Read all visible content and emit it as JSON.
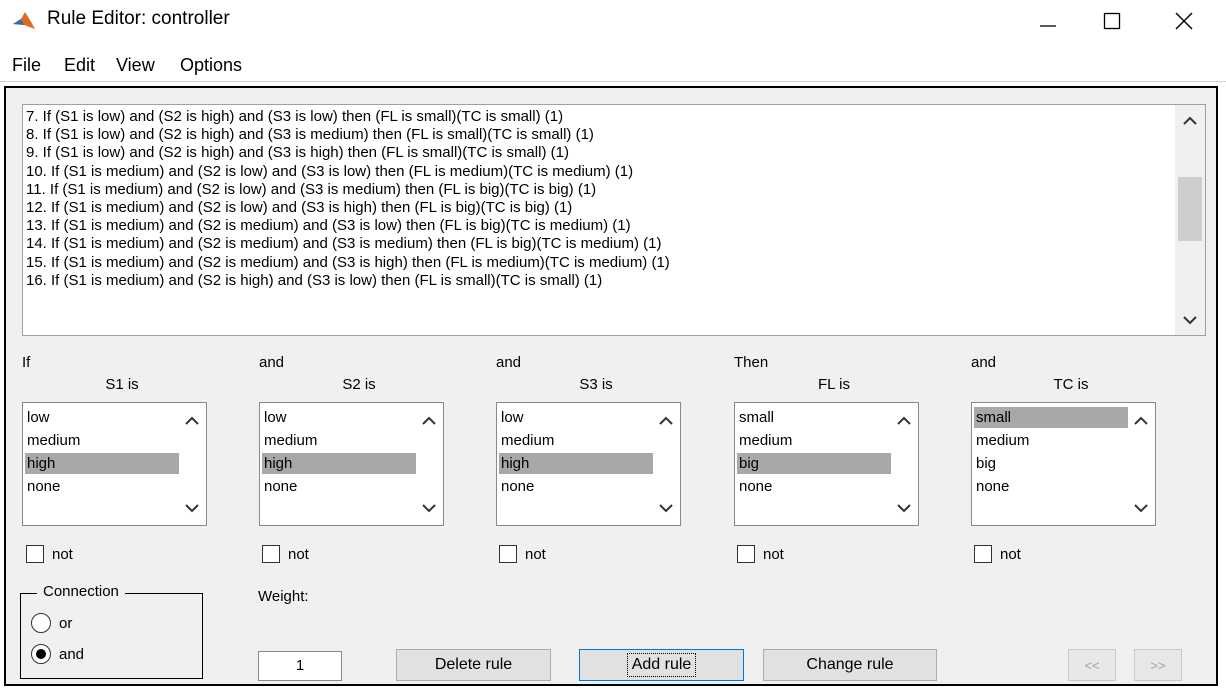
{
  "window": {
    "title": "Rule Editor: controller",
    "controls": {
      "minimize": "—",
      "maximize": "☐",
      "close": "✕"
    }
  },
  "menu": [
    "File",
    "Edit",
    "View",
    "Options"
  ],
  "rules": [
    "7. If (S1 is low) and (S2 is high) and (S3 is low) then (FL is small)(TC is small) (1)",
    "8. If (S1 is low) and (S2 is high) and (S3 is medium) then (FL is small)(TC is small) (1)",
    "9. If (S1 is low) and (S2 is high) and (S3 is high) then (FL is small)(TC is small) (1)",
    "10. If (S1 is medium) and (S2 is low) and (S3 is low) then (FL is medium)(TC is medium) (1)",
    "11. If (S1 is medium) and (S2 is low) and (S3 is medium) then (FL is big)(TC is big) (1)",
    "12. If (S1 is medium) and (S2 is low) and (S3 is high) then (FL is big)(TC is big) (1)",
    "13. If (S1 is medium) and (S2 is medium) and (S3 is low) then (FL is big)(TC is medium) (1)",
    "14. If (S1 is medium) and (S2 is medium) and (S3 is medium) then (FL is big)(TC is medium) (1)",
    "15. If (S1 is medium) and (S2 is medium) and (S3 is high) then (FL is medium)(TC is medium) (1)",
    "16. If (S1 is medium) and (S2 is high) and (S3 is low) then (FL is small)(TC is small) (1)"
  ],
  "columns": [
    {
      "head": "If",
      "name": "S1 is",
      "items": [
        "low",
        "medium",
        "high",
        "none"
      ],
      "selected": 2,
      "not": "not"
    },
    {
      "head": "and",
      "name": "S2 is",
      "items": [
        "low",
        "medium",
        "high",
        "none"
      ],
      "selected": 2,
      "not": "not"
    },
    {
      "head": "and",
      "name": "S3 is",
      "items": [
        "low",
        "medium",
        "high",
        "none"
      ],
      "selected": 2,
      "not": "not"
    },
    {
      "head": "Then",
      "name": "FL is",
      "items": [
        "small",
        "medium",
        "big",
        "none"
      ],
      "selected": 2,
      "not": "not"
    },
    {
      "head": "and",
      "name": "TC is",
      "items": [
        "small",
        "medium",
        "big",
        "none"
      ],
      "selected": 0,
      "not": "not"
    }
  ],
  "connection": {
    "label": "Connection",
    "options": [
      "or",
      "and"
    ],
    "selected": "and"
  },
  "weight": {
    "label": "Weight:",
    "value": "1"
  },
  "buttons": {
    "delete": "Delete rule",
    "add": "Add rule",
    "change": "Change rule",
    "prev": "<<",
    "next": ">>"
  }
}
